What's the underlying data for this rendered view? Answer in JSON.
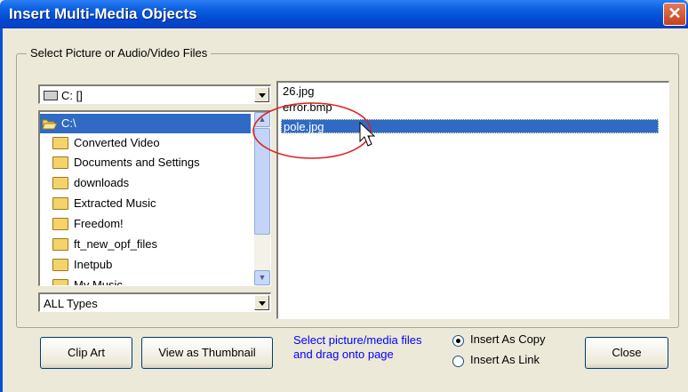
{
  "window": {
    "title": "Insert Multi-Media Objects",
    "close_glyph": "✕"
  },
  "group": {
    "label": "Select Picture or Audio/Video Files"
  },
  "drive": {
    "value": "C: []",
    "icon": "drive-icon"
  },
  "directories": [
    {
      "label": "C:\\",
      "icon": "open-folder-icon",
      "selected": true
    },
    {
      "label": "Converted Video",
      "icon": "folder-icon"
    },
    {
      "label": "Documents and Settings",
      "icon": "folder-icon"
    },
    {
      "label": "downloads",
      "icon": "folder-icon"
    },
    {
      "label": "Extracted Music",
      "icon": "folder-icon"
    },
    {
      "label": "Freedom!",
      "icon": "folder-icon"
    },
    {
      "label": "ft_new_opf_files",
      "icon": "folder-icon"
    },
    {
      "label": "Inetpub",
      "icon": "folder-icon"
    },
    {
      "label": "My Music",
      "icon": "folder-icon"
    }
  ],
  "file_types": {
    "value": "ALL Types"
  },
  "files": [
    {
      "name": "26.jpg"
    },
    {
      "name": "error.bmp"
    },
    {
      "name": "pole.jpg",
      "selected": true
    }
  ],
  "buttons": {
    "clip_art": "Clip Art",
    "thumbnail": "View as Thumbnail",
    "close": "Close"
  },
  "hint": {
    "line1": "Select picture/media files",
    "line2": "and drag onto page"
  },
  "insert_mode": {
    "copy": "Insert As Copy",
    "link": "Insert As Link",
    "selected": "copy"
  },
  "colors": {
    "title_bar": "#0a5ee0",
    "selection": "#316ac5",
    "hint_text": "#0000ff",
    "annotation": "#e02020"
  }
}
